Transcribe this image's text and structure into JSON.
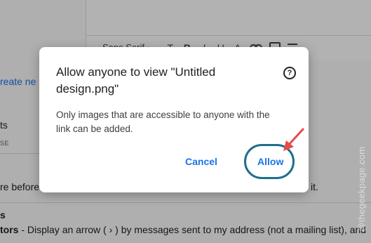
{
  "background": {
    "toolbar": {
      "font_name": "Sans Serif",
      "items": [
        "T",
        "B",
        "I",
        "U",
        "A"
      ]
    },
    "create_link": "reate ne",
    "left_label": "ts",
    "left_small": "SE",
    "line_before": "re before",
    "line_end": "it.",
    "section_heading": "s",
    "indicators_bold": "tors",
    "indicators_text": " - Display an arrow ( › ) by messages sent to my address (not a mailing list), and",
    "watermark": "@thegeekpage.com"
  },
  "dialog": {
    "title": "Allow anyone to view \"Untitled design.png\"",
    "help_icon": "?",
    "body": "Only images that are accessible to anyone with the link can be added.",
    "cancel_label": "Cancel",
    "allow_label": "Allow"
  },
  "colors": {
    "accent": "#1a73e8",
    "highlight_ring": "#1f6f8b",
    "annotation_arrow": "#e84a4a"
  }
}
